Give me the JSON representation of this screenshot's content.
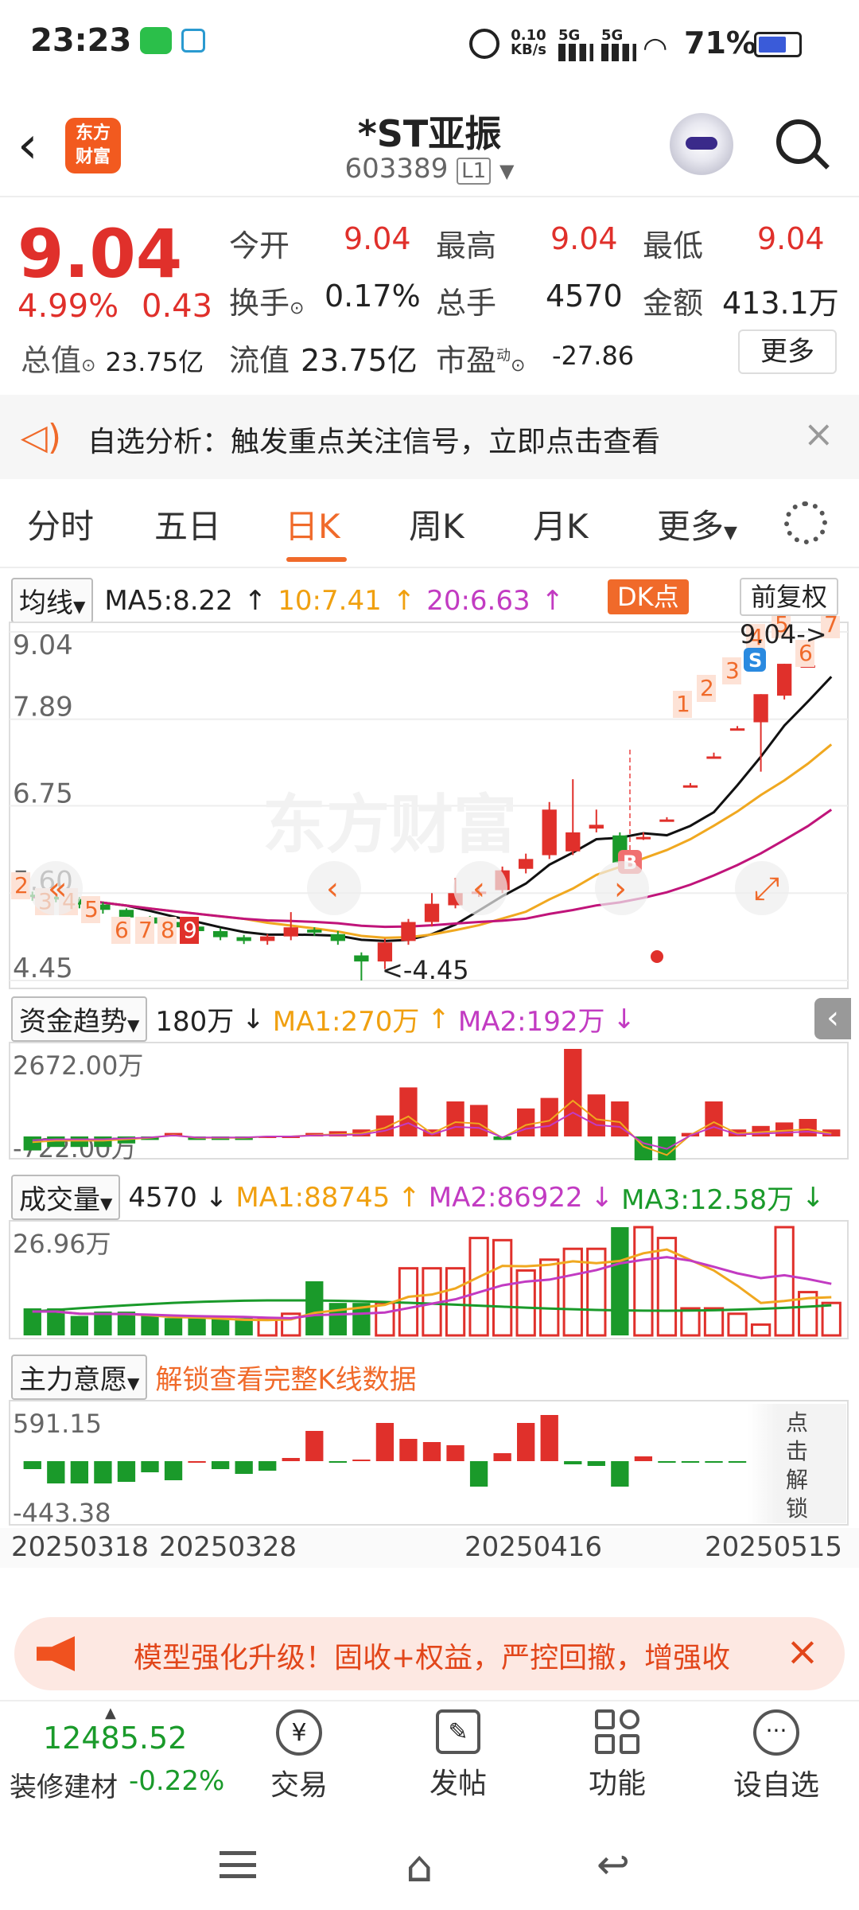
{
  "status": {
    "time": "23:23",
    "speed": "0.10",
    "speed_unit": "KB/s",
    "net1": "5G",
    "net2": "5G",
    "battery": "71%"
  },
  "header": {
    "logo_line1": "东方",
    "logo_line2": "财富",
    "title": "*ST亚振",
    "code": "603389",
    "level": "L1"
  },
  "quote": {
    "price": "9.04",
    "pct": "4.99%",
    "chg": "0.43",
    "open_label": "今开",
    "open": "9.04",
    "high_label": "最高",
    "high": "9.04",
    "low_label": "最低",
    "low": "9.04",
    "turnover_label": "换手",
    "turnover": "0.17%",
    "vol_label": "总手",
    "vol": "4570",
    "amount_label": "金额",
    "amount": "413.1万",
    "mktcap_label": "总值",
    "mktcap": "23.75亿",
    "float_label": "流值",
    "float": "23.75亿",
    "pe_label": "市盈",
    "pe_sup": "动",
    "pe": "-27.86",
    "more": "更多"
  },
  "banner": {
    "text": "自选分析：触发重点关注信号，立即点击查看"
  },
  "tabs": [
    "分时",
    "五日",
    "日K",
    "周K",
    "月K",
    "更多"
  ],
  "active_tab": "日K",
  "kline": {
    "ma_select": "均线",
    "ma5": "MA5:8.22",
    "ma10": "10:7.41",
    "ma20": "20:6.63",
    "dk": "DK点",
    "fq": "前复权",
    "y_labels": [
      "9.04",
      "7.89",
      "6.75",
      "5.60",
      "4.45"
    ],
    "max_tag": "9.04->",
    "min_tag": "<-4.45",
    "watermark": "东方财富",
    "left_nums": [
      "2",
      "3",
      "4",
      "5",
      "6",
      "7",
      "8",
      "9"
    ],
    "right_nums": [
      "1",
      "2",
      "3",
      "4",
      "5",
      "6",
      "7"
    ],
    "s_tag": "S",
    "b_tag": "B"
  },
  "fund": {
    "select": "资金趋势",
    "value": "180万",
    "ma1": "MA1:270万",
    "ma2": "MA2:192万",
    "ytop": "2672.00万",
    "ybot": "-722.00万"
  },
  "volume": {
    "select": "成交量",
    "value": "4570",
    "ma1": "MA1:88745",
    "ma2": "MA2:86922",
    "ma3": "MA3:12.58万",
    "ytop": "26.96万"
  },
  "main": {
    "select": "主力意愿",
    "unlock": "解锁查看完整K线数据",
    "ytop": "591.15",
    "ybot": "-443.38",
    "side": "点击解锁"
  },
  "dates": [
    "20250318",
    "20250328",
    "20250416",
    "20250515"
  ],
  "ad": {
    "text": "模型强化升级！固收+权益，严控回撤，增强收"
  },
  "bottom": {
    "index_value": "12485.52",
    "index_name": "装修建材",
    "index_pct": "-0.22%",
    "btns": [
      "交易",
      "发帖",
      "功能",
      "设自选"
    ]
  },
  "colors": {
    "up": "#e0302b",
    "down": "#1a9a2a",
    "accent": "#f06a2a"
  },
  "chart_data": {
    "type": "candlestick",
    "title": "*ST亚振 日K",
    "ylim": [
      4.45,
      9.04
    ],
    "candles": [
      {
        "o": 5.58,
        "c": 5.55,
        "h": 5.62,
        "l": 5.5
      },
      {
        "o": 5.55,
        "c": 5.52,
        "h": 5.58,
        "l": 5.48
      },
      {
        "o": 5.52,
        "c": 5.45,
        "h": 5.55,
        "l": 5.4
      },
      {
        "o": 5.45,
        "c": 5.38,
        "h": 5.48,
        "l": 5.33
      },
      {
        "o": 5.38,
        "c": 5.28,
        "h": 5.4,
        "l": 5.24
      },
      {
        "o": 5.28,
        "c": 5.2,
        "h": 5.3,
        "l": 5.15
      },
      {
        "o": 5.22,
        "c": 5.15,
        "h": 5.25,
        "l": 5.1
      },
      {
        "o": 5.16,
        "c": 5.1,
        "h": 5.18,
        "l": 5.06
      },
      {
        "o": 5.1,
        "c": 5.02,
        "h": 5.14,
        "l": 4.98
      },
      {
        "o": 5.02,
        "c": 4.97,
        "h": 5.05,
        "l": 4.93
      },
      {
        "o": 4.97,
        "c": 5.03,
        "h": 5.06,
        "l": 4.92
      },
      {
        "o": 5.03,
        "c": 5.15,
        "h": 5.35,
        "l": 4.98
      },
      {
        "o": 5.12,
        "c": 5.08,
        "h": 5.15,
        "l": 5.04
      },
      {
        "o": 5.06,
        "c": 4.97,
        "h": 5.1,
        "l": 4.92
      },
      {
        "o": 4.78,
        "c": 4.7,
        "h": 4.82,
        "l": 4.45
      },
      {
        "o": 4.7,
        "c": 4.95,
        "h": 5.0,
        "l": 4.6
      },
      {
        "o": 4.97,
        "c": 5.22,
        "h": 5.26,
        "l": 4.92
      },
      {
        "o": 5.22,
        "c": 5.46,
        "h": 5.6,
        "l": 5.16
      },
      {
        "o": 5.44,
        "c": 5.6,
        "h": 5.8,
        "l": 5.4
      },
      {
        "o": 5.6,
        "c": 5.62,
        "h": 5.68,
        "l": 5.55
      },
      {
        "o": 5.64,
        "c": 5.9,
        "h": 5.95,
        "l": 5.6
      },
      {
        "o": 5.92,
        "c": 6.05,
        "h": 6.12,
        "l": 5.86
      },
      {
        "o": 6.1,
        "c": 6.7,
        "h": 6.8,
        "l": 6.05
      },
      {
        "o": 6.15,
        "c": 6.4,
        "h": 7.1,
        "l": 6.1
      },
      {
        "o": 6.45,
        "c": 6.5,
        "h": 6.7,
        "l": 6.4
      },
      {
        "o": 6.36,
        "c": 6.0,
        "h": 6.4,
        "l": 5.95
      },
      {
        "o": 6.32,
        "c": 6.34,
        "h": 6.4,
        "l": 6.3
      },
      {
        "o": 6.55,
        "c": 6.57,
        "h": 6.6,
        "l": 6.55
      },
      {
        "o": 7.0,
        "c": 7.02,
        "h": 7.05,
        "l": 7.0
      },
      {
        "o": 7.38,
        "c": 7.4,
        "h": 7.45,
        "l": 7.38
      },
      {
        "o": 7.75,
        "c": 7.77,
        "h": 7.8,
        "l": 7.75
      },
      {
        "o": 7.85,
        "c": 8.22,
        "h": 8.22,
        "l": 7.2
      },
      {
        "o": 8.2,
        "c": 8.62,
        "h": 8.62,
        "l": 8.15
      },
      {
        "o": 8.6,
        "c": 8.6,
        "h": 8.6,
        "l": 8.6
      },
      {
        "o": 9.04,
        "c": 9.04,
        "h": 9.04,
        "l": 9.04
      }
    ]
  }
}
